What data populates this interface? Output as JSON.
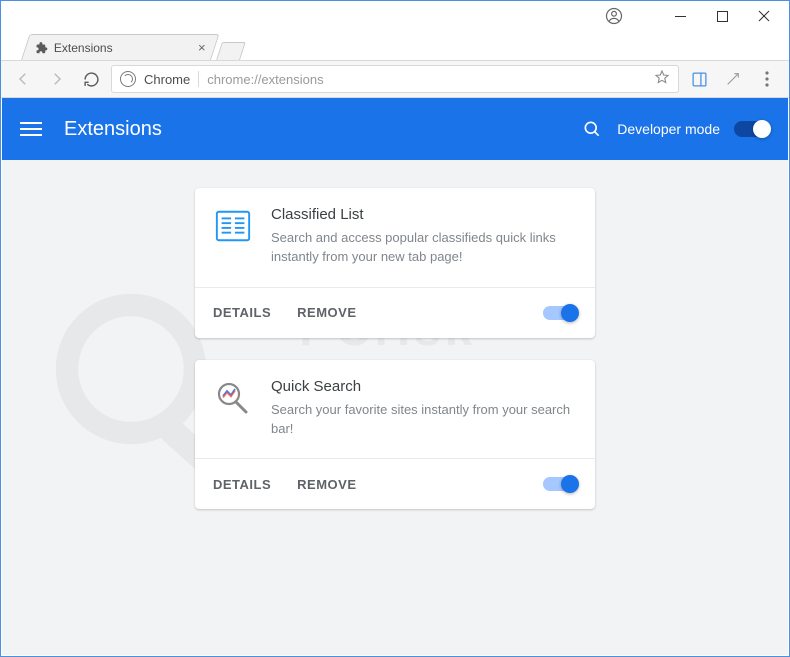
{
  "window": {
    "tab_title": "Extensions"
  },
  "toolbar": {
    "omnibox_label": "Chrome",
    "omnibox_url": "chrome://extensions"
  },
  "header": {
    "title": "Extensions",
    "dev_mode_label": "Developer mode",
    "dev_mode_on": true
  },
  "extensions": [
    {
      "name": "Classified List",
      "description": "Search and access popular classifieds quick links instantly from your new tab page!",
      "enabled": true,
      "details_label": "DETAILS",
      "remove_label": "REMOVE"
    },
    {
      "name": "Quick Search",
      "description": "Search your favorite sites instantly from your search bar!",
      "enabled": true,
      "details_label": "DETAILS",
      "remove_label": "REMOVE"
    }
  ]
}
